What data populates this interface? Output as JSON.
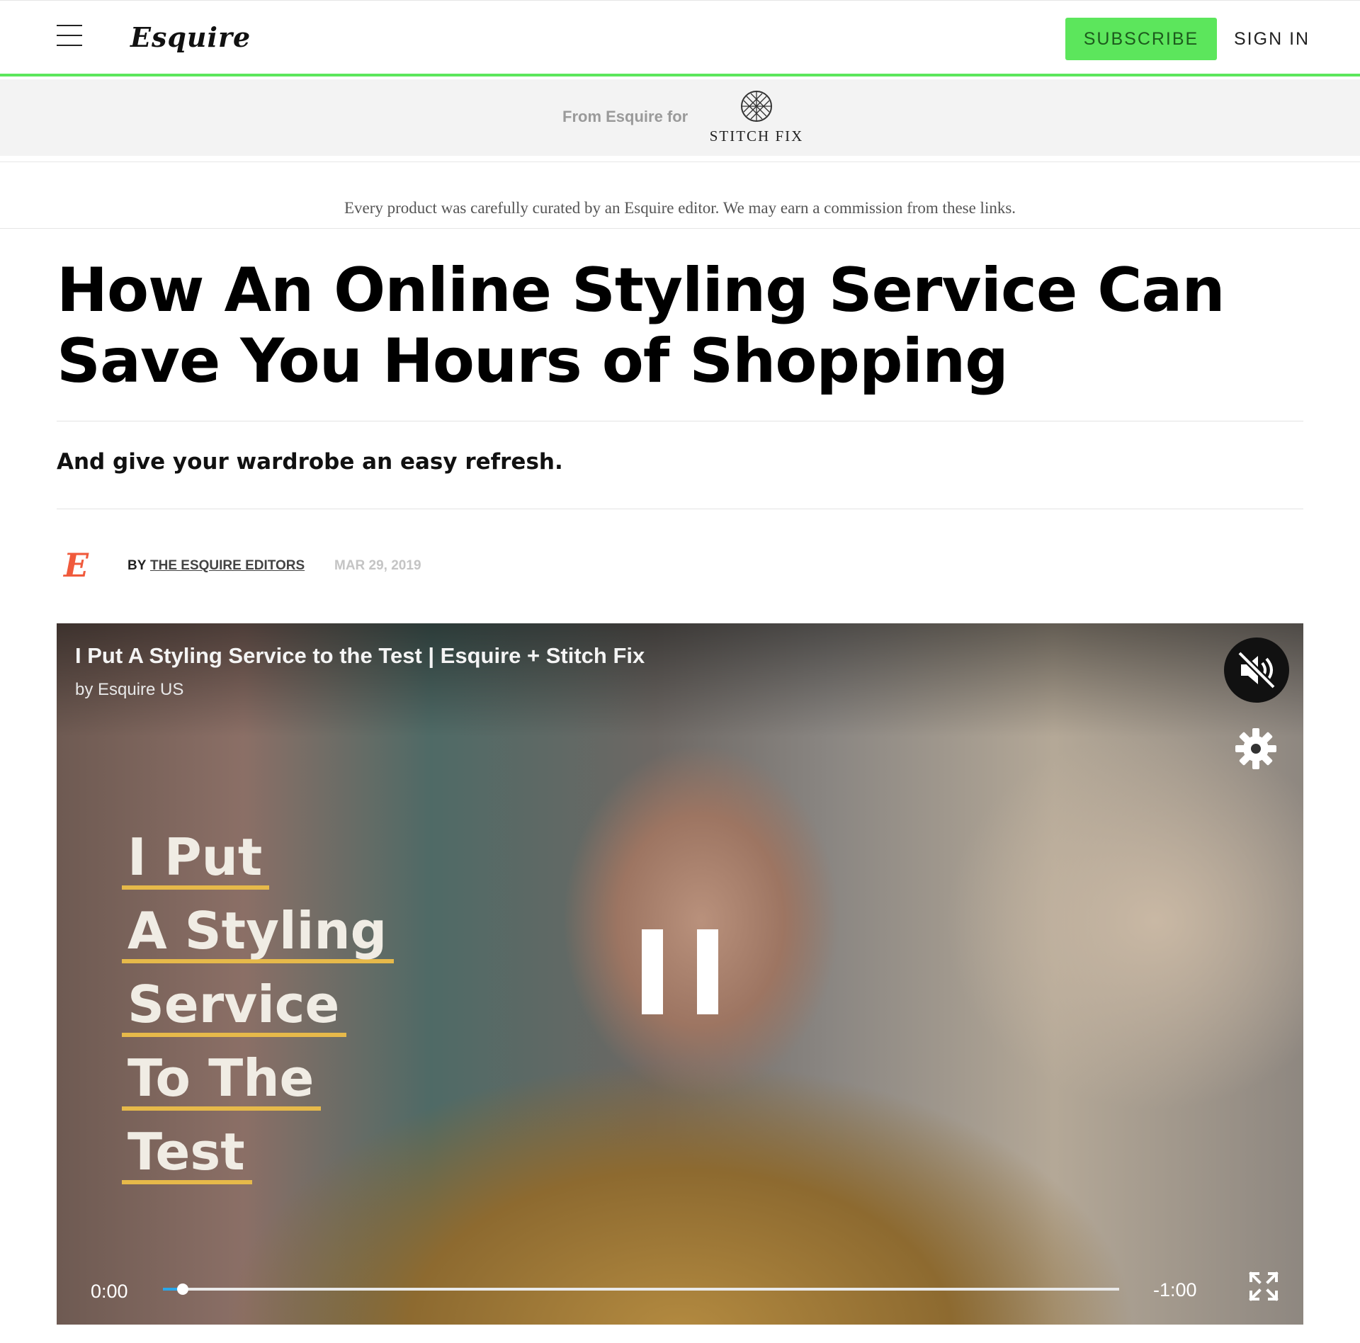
{
  "header": {
    "logo_text": "Esquire",
    "subscribe_label": "SUBSCRIBE",
    "signin_label": "SIGN IN",
    "accent_color": "#5ce65c"
  },
  "sponsor": {
    "prefix": "From Esquire for",
    "brand_name": "STITCH FIX"
  },
  "disclaimer": "Every product was carefully curated by an Esquire editor. We may earn a commission from these links.",
  "article": {
    "headline": "How An Online Styling Service Can Save You Hours of Shopping",
    "dek": "And give your wardrobe an easy refresh.",
    "byline": {
      "prefix": "BY",
      "author": "THE ESQUIRE EDITORS",
      "date": "MAR 29, 2019",
      "avatar_letter": "E",
      "avatar_color": "#f05a3c"
    }
  },
  "video": {
    "title": "I Put A Styling Service to the Test | Esquire + Stitch Fix",
    "channel": "by Esquire US",
    "overlay_lines": [
      "I Put",
      "A Styling",
      "Service",
      "To The",
      "Test"
    ],
    "current_time": "0:00",
    "remaining_time": "-1:00",
    "progress_fraction": 0.01,
    "state": "playing",
    "muted": true
  }
}
